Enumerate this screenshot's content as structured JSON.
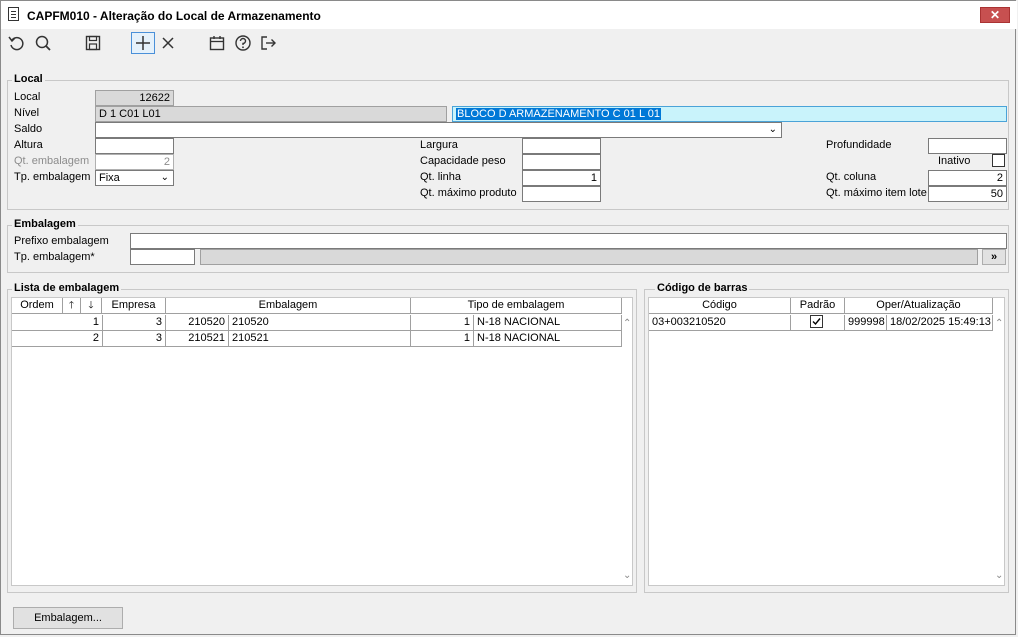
{
  "window": {
    "title": "CAPFM010 - Alteração do Local de Armazenamento",
    "close_label": "✕"
  },
  "toolbar": {
    "icons": [
      "undo-icon",
      "search-icon",
      "save-icon",
      "add-icon",
      "delete-icon",
      "calendar-icon",
      "help-icon",
      "exit-icon"
    ]
  },
  "local": {
    "legend": "Local",
    "local_label": "Local",
    "local_value": "12622",
    "nivel_label": "Nível",
    "nivel_value": "D 1 C01 L01",
    "nivel_desc": "BLOCO D ARMAZENAMENTO C 01 L 01",
    "saldo_label": "Saldo",
    "saldo_value": "",
    "altura_label": "Altura",
    "altura_value": "",
    "qt_embalagem_label": "Qt. embalagem",
    "qt_embalagem_value": "2",
    "tp_embalagem_label": "Tp. embalagem",
    "tp_embalagem_value": "Fixa",
    "largura_label": "Largura",
    "largura_value": "",
    "capacidade_peso_label": "Capacidade peso",
    "capacidade_peso_value": "",
    "qt_linha_label": "Qt. linha",
    "qt_linha_value": "1",
    "qt_maximo_produto_label": "Qt. máximo produto",
    "qt_maximo_produto_value": "",
    "profundidade_label": "Profundidade",
    "profundidade_value": "",
    "inativo_label": "Inativo",
    "inativo_checked": false,
    "qt_coluna_label": "Qt. coluna",
    "qt_coluna_value": "2",
    "qt_maximo_item_lote_label": "Qt. máximo item lote",
    "qt_maximo_item_lote_value": "50"
  },
  "embalagem": {
    "legend": "Embalagem",
    "prefixo_label": "Prefixo embalagem",
    "prefixo_value": "",
    "tp_label": "Tp. embalagem*",
    "tp_value": "",
    "tp_desc": "",
    "lookup_label": "»"
  },
  "lista_embalagem": {
    "legend": "Lista de embalagem",
    "headers": {
      "ordem": "Ordem",
      "up": "🡑",
      "down": "🡓",
      "empresa": "Empresa",
      "embalagem": "Embalagem",
      "tipo": "Tipo de embalagem"
    },
    "rows": [
      {
        "ordem": "1",
        "empresa": "3",
        "emb_code": "210520",
        "emb_desc": "210520",
        "tipo_code": "1",
        "tipo_desc": "N-18 NACIONAL"
      },
      {
        "ordem": "2",
        "empresa": "3",
        "emb_code": "210521",
        "emb_desc": "210521",
        "tipo_code": "1",
        "tipo_desc": "N-18 NACIONAL"
      }
    ]
  },
  "codigo_barras": {
    "legend": "Código de barras",
    "headers": {
      "codigo": "Código",
      "padrao": "Padrão",
      "oper": "Oper/Atualização"
    },
    "rows": [
      {
        "codigo": "03+003210520",
        "padrao_checked": true,
        "oper": "999998",
        "atualizacao": "18/02/2025 15:49:13"
      }
    ]
  },
  "footer": {
    "embalagem_button": "Embalagem..."
  }
}
